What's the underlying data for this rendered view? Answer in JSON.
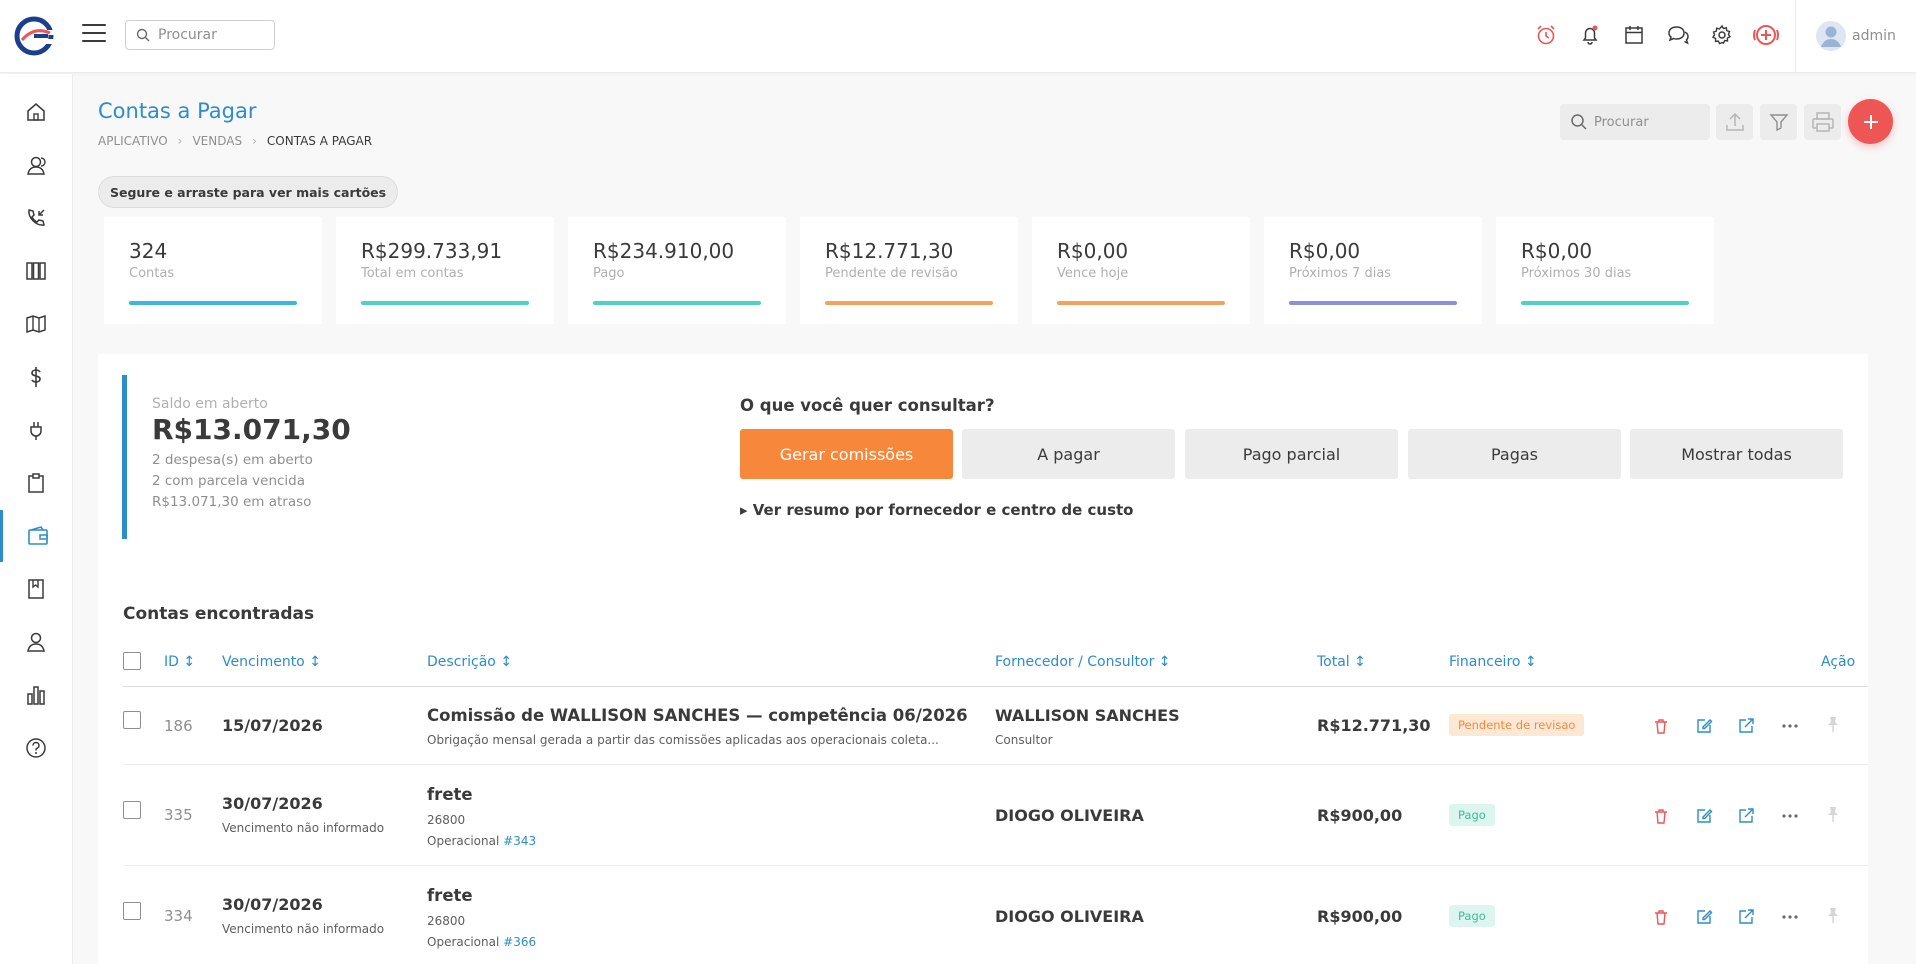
{
  "topbar": {
    "search_placeholder": "Procurar",
    "icons": [
      "alarm-clock-icon",
      "bell-icon",
      "calendar-icon",
      "chat-icon",
      "gear-icon",
      "help-plus-icon"
    ],
    "user_name": "admin"
  },
  "sidebar": {
    "items": [
      "home",
      "contacts",
      "calls",
      "columns",
      "map",
      "dollar",
      "plug",
      "clipboard",
      "wallet",
      "bookmark",
      "user",
      "bar-chart",
      "help"
    ],
    "active": "wallet"
  },
  "header": {
    "title": "Contas a Pagar",
    "breadcrumb": [
      "APLICATIVO",
      "VENDAS",
      "CONTAS A PAGAR"
    ],
    "search_placeholder": "Procurar"
  },
  "hint": "Segure e arraste para ver mais cartões",
  "cards": [
    {
      "value": "324",
      "label": "Contas",
      "color": "#3db8dc"
    },
    {
      "value": "R$299.733,91",
      "label": "Total em contas",
      "color": "#4fd1c5"
    },
    {
      "value": "R$234.910,00",
      "label": "Pago",
      "color": "#4fd1c5"
    },
    {
      "value": "R$12.771,30",
      "label": "Pendente de revisão",
      "color": "#f4a261"
    },
    {
      "value": "R$0,00",
      "label": "Vence hoje",
      "color": "#f4a261"
    },
    {
      "value": "R$0,00",
      "label": "Próximos 7 dias",
      "color": "#8c8fd9"
    },
    {
      "value": "R$0,00",
      "label": "Próximos 30 dias",
      "color": "#4fd1c5"
    }
  ],
  "balance": {
    "label": "Saldo em aberto",
    "value": "R$13.071,30",
    "line1": "2 despesa(s) em aberto",
    "line2": "2 com parcela vencida",
    "line3": "R$13.071,30 em atraso"
  },
  "query": {
    "question": "O que você quer consultar?",
    "buttons": [
      "Gerar comissões",
      "A pagar",
      "Pago parcial",
      "Pagas",
      "Mostrar todas"
    ],
    "summary_link": "▸ Ver resumo por fornecedor e centro de custo"
  },
  "table": {
    "title": "Contas encontradas",
    "headers": {
      "id": "ID ↕",
      "due": "Vencimento ↕",
      "desc": "Descrição ↕",
      "vendor": "Fornecedor / Consultor ↕",
      "total": "Total ↕",
      "finance": "Financeiro ↕",
      "action": "Ação"
    },
    "rows": [
      {
        "id": "186",
        "date": "15/07/2026",
        "date_note": "",
        "title": "Comissão de WALLISON SANCHES — competência 06/2026",
        "sub1": "Obrigação mensal gerada a partir das comissões aplicadas aos operacionais coleta...",
        "sub2_label": "",
        "sub2_link": "",
        "vendor": "WALLISON SANCHES",
        "vendor_role": "Consultor",
        "total": "R$12.771,30",
        "status": "Pendente de revisao"
      },
      {
        "id": "335",
        "date": "30/07/2026",
        "date_note": "Vencimento não informado",
        "title": "frete",
        "sub1": "26800",
        "sub2_label": "Operacional",
        "sub2_link": "#343",
        "vendor": "DIOGO OLIVEIRA",
        "vendor_role": "",
        "total": "R$900,00",
        "status": "Pago"
      },
      {
        "id": "334",
        "date": "30/07/2026",
        "date_note": "Vencimento não informado",
        "title": "frete",
        "sub1": "26800",
        "sub2_label": "Operacional",
        "sub2_link": "#366",
        "vendor": "DIOGO OLIVEIRA",
        "vendor_role": "",
        "total": "R$900,00",
        "status": "Pago"
      }
    ]
  }
}
